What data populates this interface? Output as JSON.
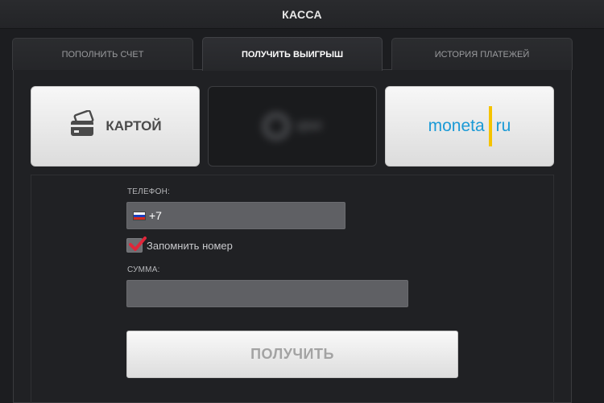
{
  "header": {
    "title": "КАССА"
  },
  "tabs": [
    {
      "label": "ПОПОЛНИТЬ СЧЕТ",
      "active": false
    },
    {
      "label": "ПОЛУЧИТЬ ВЫИГРЫШ",
      "active": true
    },
    {
      "label": "ИСТОРИЯ ПЛАТЕЖЕЙ",
      "active": false
    }
  ],
  "payment_methods": [
    {
      "label": "КАРТОЙ",
      "icon": "credit-card-icon"
    },
    {
      "label": "qiwi",
      "icon": "qiwi-logo-blurred"
    },
    {
      "label": "moneta",
      "label_suffix": "ru",
      "icon": "moneta-logo"
    }
  ],
  "form": {
    "phone_label": "ТЕЛЕФОН:",
    "phone_value": "+7",
    "remember_label": "Запомнить номер",
    "remember_checked": true,
    "amount_label": "СУММА:",
    "amount_value": "",
    "submit_label": "ПОЛУЧИТЬ"
  },
  "colors": {
    "background": "#1c1d20",
    "accent_moneta_blue": "#1b9ad6",
    "accent_moneta_yellow": "#f5c300",
    "check_red": "#e0263a"
  }
}
